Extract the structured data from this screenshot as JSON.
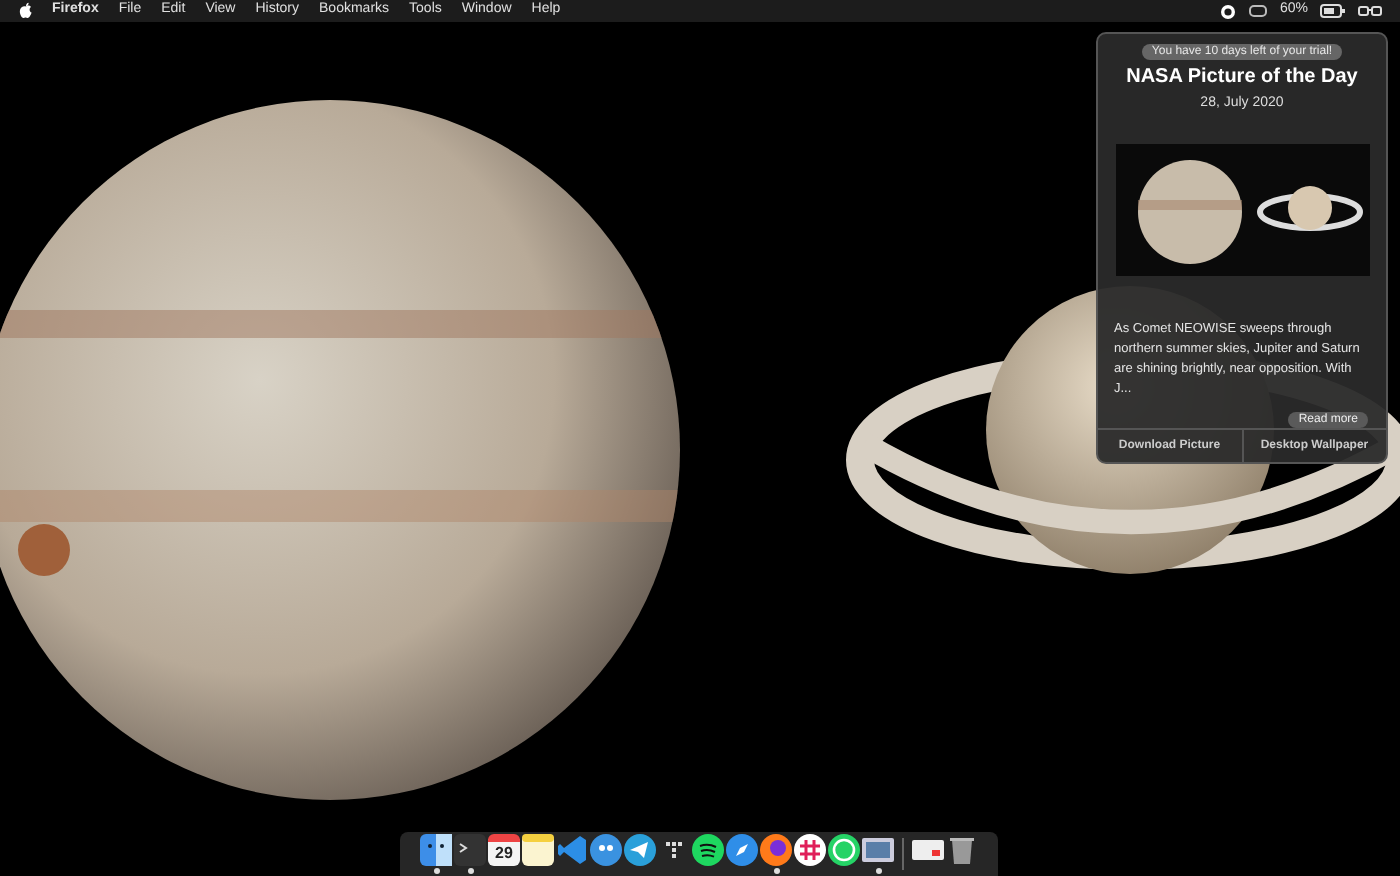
{
  "menu_bar": {
    "app_name": "Firefox",
    "menus": [
      "File",
      "Edit",
      "View",
      "History",
      "Bookmarks",
      "Tools",
      "Window",
      "Help"
    ],
    "battery_percent": "60%"
  },
  "popup": {
    "trial_notice": "You have 10 days left of your trial!",
    "title": "NASA Picture of the Day",
    "date": "28, July 2020",
    "description": "As Comet NEOWISE sweeps through northern summer skies, Jupiter and Saturn are shining brightly, near opposition. With J...",
    "read_more": "Read more",
    "buttons": [
      "Download Picture",
      "Desktop Wallpaper"
    ]
  },
  "dock": {
    "items": [
      {
        "kind": "finder",
        "running": true
      },
      {
        "kind": "terminal",
        "running": true
      },
      {
        "kind": "calendar",
        "running": false,
        "day": "29"
      },
      {
        "kind": "notes",
        "running": false
      },
      {
        "kind": "code",
        "running": false
      },
      {
        "kind": "bird",
        "running": false
      },
      {
        "kind": "telegram",
        "running": false
      },
      {
        "kind": "dots",
        "running": false
      },
      {
        "kind": "spotify",
        "running": false
      },
      {
        "kind": "safari",
        "running": false
      },
      {
        "kind": "firefox",
        "running": true
      },
      {
        "kind": "slack",
        "running": false
      },
      {
        "kind": "whatsapp",
        "running": false
      },
      {
        "kind": "preview",
        "running": true
      },
      {
        "kind": "divider"
      },
      {
        "kind": "window",
        "running": false
      },
      {
        "kind": "trash",
        "running": false
      }
    ]
  }
}
